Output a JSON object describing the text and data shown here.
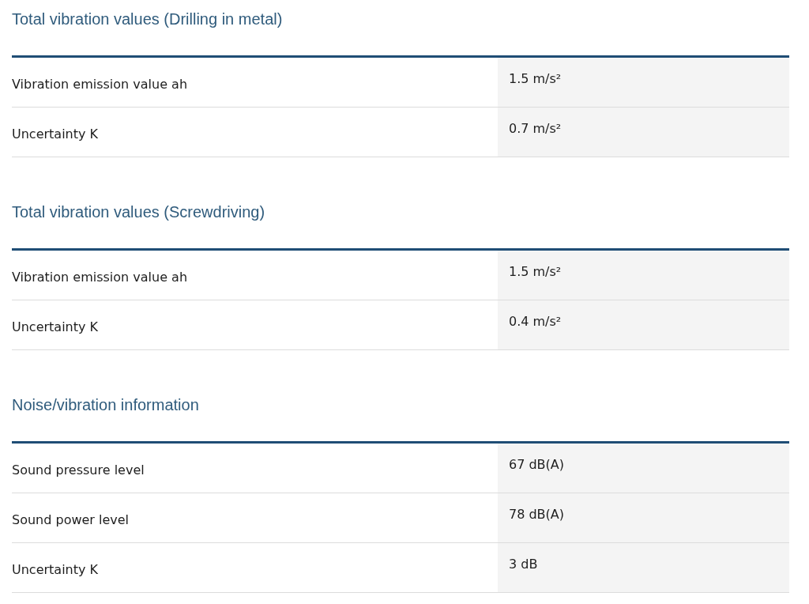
{
  "sections": [
    {
      "title": "Total vibration values (Drilling in metal)",
      "rows": [
        {
          "label": "Vibration emission value ah",
          "value": "1.5 m/s²"
        },
        {
          "label": "Uncertainty K",
          "value": "0.7 m/s²"
        }
      ]
    },
    {
      "title": "Total vibration values (Screwdriving)",
      "rows": [
        {
          "label": "Vibration emission value ah",
          "value": "1.5 m/s²"
        },
        {
          "label": "Uncertainty K",
          "value": "0.4 m/s²"
        }
      ]
    },
    {
      "title": "Noise/vibration information",
      "rows": [
        {
          "label": "Sound pressure level",
          "value": "67 dB(A)"
        },
        {
          "label": "Sound power level",
          "value": "78 dB(A)"
        },
        {
          "label": "Uncertainty K",
          "value": "3 dB"
        }
      ]
    }
  ]
}
